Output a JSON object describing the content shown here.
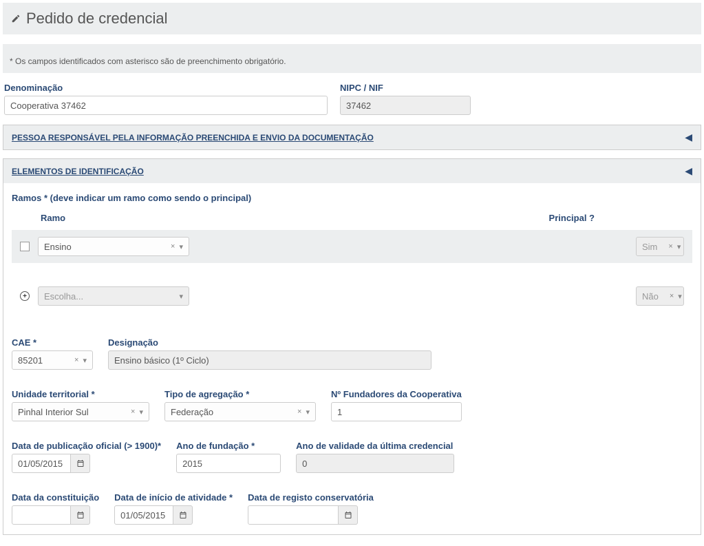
{
  "page": {
    "title": "Pedido de credencial"
  },
  "notice": "* Os campos identificados com asterisco são de preenchimento obrigatório.",
  "denominacao": {
    "label": "Denominação",
    "value": "Cooperativa 37462"
  },
  "nipc": {
    "label": "NIPC / NIF",
    "value": "37462"
  },
  "panel_pessoa": {
    "title": "PESSOA RESPONSÁVEL PELA INFORMAÇÃO PREENCHIDA E ENVIO DA DOCUMENTAÇÃO"
  },
  "panel_elementos": {
    "title": "ELEMENTOS DE IDENTIFICAÇÃO",
    "ramos_label": "Ramos * (deve indicar um ramo como sendo o principal)",
    "head_ramo": "Ramo",
    "head_principal": "Principal ?",
    "row1": {
      "ramo": "Ensino",
      "principal": "Sim"
    },
    "row2": {
      "placeholder": "Escolha...",
      "principal": "Não"
    },
    "cae": {
      "label": "CAE *",
      "value": "85201"
    },
    "designacao": {
      "label": "Designação",
      "value": "Ensino básico (1º Ciclo)"
    },
    "unidade": {
      "label": "Unidade territorial *",
      "value": "Pinhal Interior Sul"
    },
    "agregacao": {
      "label": "Tipo de agregação *",
      "value": "Federação"
    },
    "fundadores": {
      "label": "Nº Fundadores da Cooperativa",
      "value": "1"
    },
    "datapub": {
      "label": "Data de publicação oficial (> 1900)*",
      "value": "01/05/2015"
    },
    "anofund": {
      "label": "Ano de fundação *",
      "value": "2015"
    },
    "anovalid": {
      "label": "Ano de validade da última credencial",
      "value": "0"
    },
    "dataconst": {
      "label": "Data da constituição",
      "value": ""
    },
    "datainicio": {
      "label": "Data de início de atividade *",
      "value": "01/05/2015"
    },
    "dataregisto": {
      "label": "Data de registo conservatória",
      "value": ""
    }
  }
}
